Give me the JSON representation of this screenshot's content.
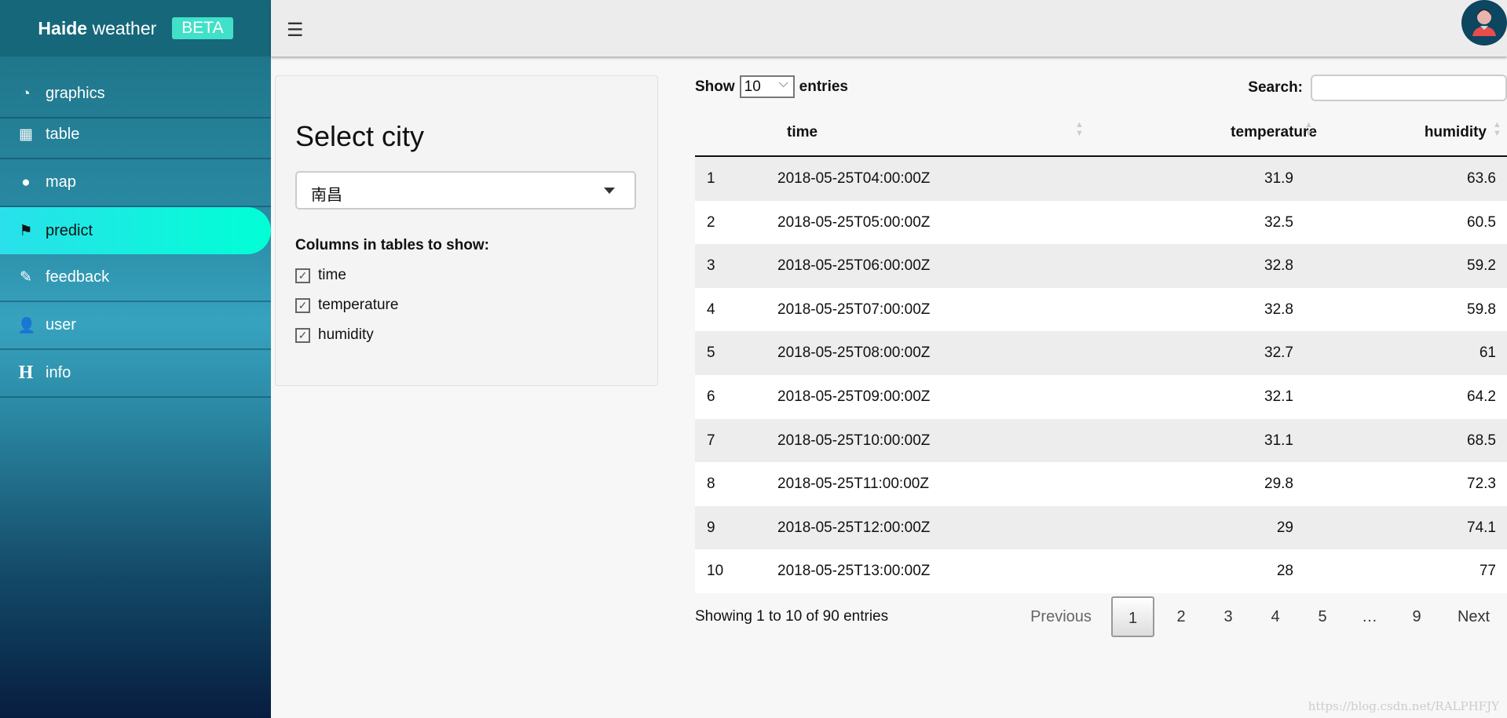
{
  "brand": {
    "name_bold": "Haide",
    "name_rest": "weather",
    "badge": "BETA"
  },
  "sidebar": {
    "items": [
      {
        "label": "graphics",
        "icon": "dashboard-icon"
      },
      {
        "label": "table",
        "icon": "grid-icon"
      },
      {
        "label": "map",
        "icon": "map-marker-icon"
      },
      {
        "label": "predict",
        "icon": "flag-icon",
        "active": true
      },
      {
        "label": "feedback",
        "icon": "pencil-icon"
      },
      {
        "label": "user",
        "icon": "user-icon"
      },
      {
        "label": "info",
        "icon": "header-icon"
      }
    ]
  },
  "panel": {
    "title": "Select city",
    "city": "南昌",
    "columns_label": "Columns in tables to show:",
    "columns": [
      {
        "label": "time",
        "checked": true
      },
      {
        "label": "temperature",
        "checked": true
      },
      {
        "label": "humidity",
        "checked": true
      }
    ]
  },
  "table": {
    "show": "Show",
    "entries": "entries",
    "page_size": "10",
    "search_label": "Search:",
    "search_value": "",
    "headers": [
      "time",
      "temperature",
      "humidity"
    ],
    "rows": [
      [
        "1",
        "2018-05-25T04:00:00Z",
        "31.9",
        "63.6"
      ],
      [
        "2",
        "2018-05-25T05:00:00Z",
        "32.5",
        "60.5"
      ],
      [
        "3",
        "2018-05-25T06:00:00Z",
        "32.8",
        "59.2"
      ],
      [
        "4",
        "2018-05-25T07:00:00Z",
        "32.8",
        "59.8"
      ],
      [
        "5",
        "2018-05-25T08:00:00Z",
        "32.7",
        "61"
      ],
      [
        "6",
        "2018-05-25T09:00:00Z",
        "32.1",
        "64.2"
      ],
      [
        "7",
        "2018-05-25T10:00:00Z",
        "31.1",
        "68.5"
      ],
      [
        "8",
        "2018-05-25T11:00:00Z",
        "29.8",
        "72.3"
      ],
      [
        "9",
        "2018-05-25T12:00:00Z",
        "29",
        "74.1"
      ],
      [
        "10",
        "2018-05-25T13:00:00Z",
        "28",
        "77"
      ]
    ],
    "info": "Showing 1 to 10 of 90 entries",
    "pagination": {
      "previous": "Previous",
      "pages": [
        "1",
        "2",
        "3",
        "4",
        "5",
        "…",
        "9"
      ],
      "current": "1",
      "next": "Next"
    }
  },
  "watermark": "https://blog.csdn.net/RALPHFJY"
}
